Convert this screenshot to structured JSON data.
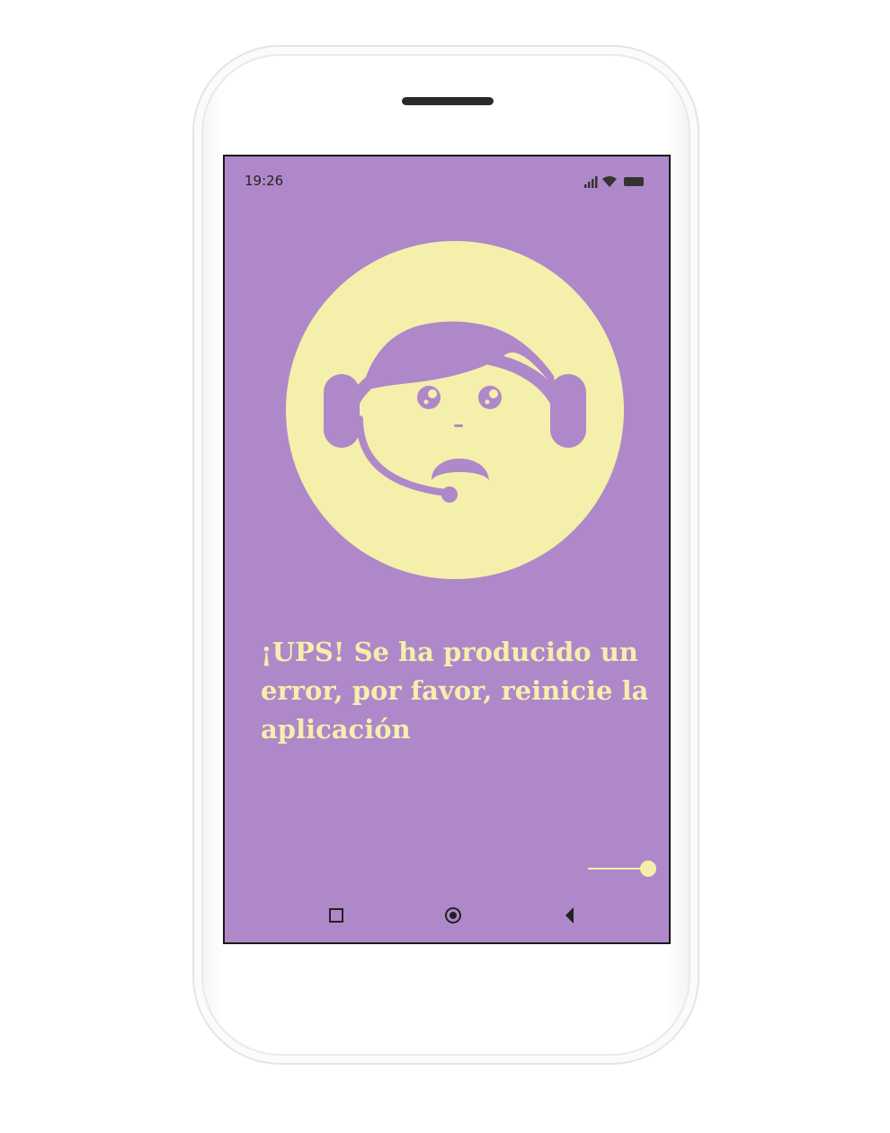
{
  "status_bar": {
    "time": "19:26",
    "icons": [
      "signal-icon",
      "wifi-icon",
      "battery-icon"
    ]
  },
  "illustration": {
    "icon": "support-agent-sad-icon"
  },
  "error": {
    "message": "¡UPS! Se ha producido un error, por favor, reinicie la aplicación"
  },
  "slider": {
    "value": 1.0
  },
  "nav_bar": {
    "buttons": [
      "recent-apps-icon",
      "home-icon",
      "back-icon"
    ]
  },
  "colors": {
    "screen_background": "#af88c9",
    "accent": "#f5efac",
    "text_dark": "#222222",
    "device_frame": "#ffffff"
  }
}
